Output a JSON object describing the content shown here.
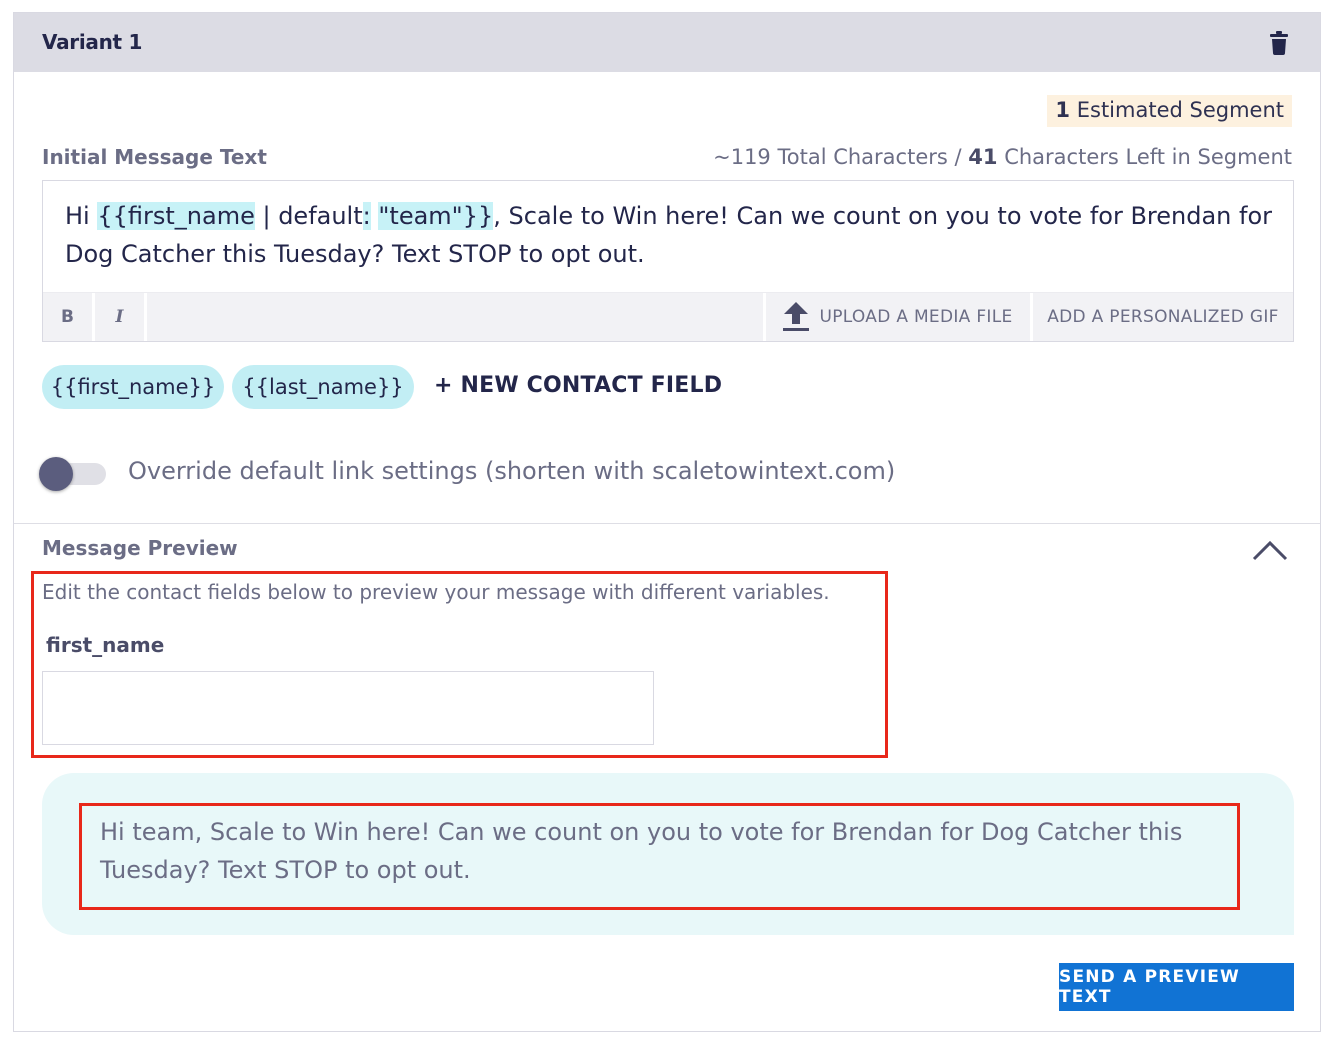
{
  "variant": {
    "title": "Variant 1",
    "delete_icon": "trash-icon"
  },
  "segment": {
    "count": "1",
    "label": "Estimated Segment"
  },
  "message": {
    "label": "Initial Message Text",
    "total_chars": "~119",
    "total_chars_label": "Total Characters",
    "separator": "/",
    "chars_left": "41",
    "chars_left_label": "Characters Left in Segment",
    "text_prefix": "Hi ",
    "token_field": "{{first_name",
    "text_default": " | default",
    "token_colon": ":",
    "text_space": " ",
    "token_default_value": "\"team\"}}",
    "text_suffix": ", Scale to Win here! Can we count on you to vote for Brendan for Dog Catcher this Tuesday? Text STOP to opt out."
  },
  "toolbar": {
    "bold_label": "B",
    "italic_label": "I",
    "upload_label": "UPLOAD A MEDIA FILE",
    "upload_icon": "upload-icon",
    "gif_label": "ADD A PERSONALIZED GIF"
  },
  "contact_fields": {
    "chips": [
      "{{first_name}}",
      "{{last_name}}"
    ],
    "new_field_label": "+ NEW CONTACT FIELD"
  },
  "link_settings": {
    "label": "Override default link settings (shorten with scaletowintext.com)",
    "enabled": false
  },
  "preview": {
    "title": "Message Preview",
    "collapse_icon": "chevron-up-icon",
    "hint": "Edit the contact fields below to preview your message with different variables.",
    "field_label": "first_name",
    "field_value": "",
    "bubble_text": "Hi team, Scale to Win here! Can we count on you to vote for Brendan for Dog Catcher this Tuesday? Text STOP to opt out.",
    "send_label": "SEND A PREVIEW TEXT"
  },
  "colors": {
    "header_bg": "#dcdce4",
    "token_highlight": "#c7f2f7",
    "primary_button": "#1173d4",
    "annotation_box": "#e8281a",
    "bubble_bg": "#e8f8f9"
  }
}
